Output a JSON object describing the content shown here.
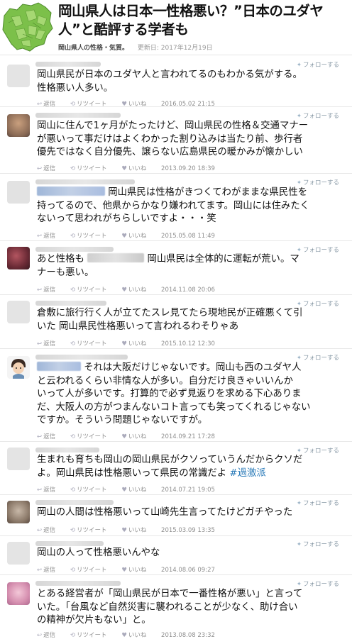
{
  "article": {
    "title": "岡山県人は日本一性格悪い？”日本のユダヤ人”と酷評する学者も",
    "category": "岡山県人の性格・気質。",
    "updated": "更新日: 2017年12月19日"
  },
  "labels": {
    "follow": "フォローする",
    "reply": "返信",
    "retweet": "リツイート",
    "like": "いいね"
  },
  "tweets": [
    {
      "lines": [
        "岡山県民が日本のユダヤ人と言われてるのもわかる気がする。",
        "性格悪い人多い。"
      ],
      "time": "2016.05.02 21:15"
    },
    {
      "lines": [
        "岡山に住んで1ヶ月がたったけど、岡山県民の性格＆交通マナー",
        "が悪いって事だけはよくわかった割り込みは当たり前、歩行者",
        "優先ではなく自分優先、譲らない広島県民の暖かみが懐かしい"
      ],
      "time": "2013.09.20 18:39"
    },
    {
      "lines": [
        "岡山県民は性格がきつくてわがままな県民性を",
        "持ってるので、他県からかなり嫌われてます。岡山には住みたく",
        "ないって思われがちらしいですよ・・・笑"
      ],
      "time": "2015.05.08 11:49"
    },
    {
      "lines": [
        "あと性格も",
        "岡山県民は全体的に運転が荒い。マ",
        "ナーも悪い。"
      ],
      "time": "2014.11.08 20:06"
    },
    {
      "lines": [
        "倉敷に旅行行く人が立てたスレ見てたら現地民が正確悪くて引",
        "いた 岡山県民性格悪いって言われるわそりゃあ"
      ],
      "time": "2015.10.12 12:30"
    },
    {
      "lines": [
        "それは大阪だけじゃないです。岡山も西のユダヤ人",
        "と云われるくらい非情な人が多い。自分だけ良きゃいいんか",
        "いって人が多いです。打算的で必ず見返りを求める下心ありま",
        "だ、大阪人の方がつまんないコト言っても笑ってくれるじゃない",
        "ですか。そういう問題じゃないですが。"
      ],
      "time": "2014.09.21 17:28"
    },
    {
      "lines": [
        "生まれも育ちも岡山の岡山県民がクソっていうんだからクソだ",
        "よ。岡山県民は性格悪いって県民の常識だよ"
      ],
      "hashtag": "#過激派",
      "time": "2014.07.21 19:05"
    },
    {
      "lines": [
        "岡山の人間は性格悪いって山崎先生言ってたけどガチやった"
      ],
      "time": "2015.03.09 13:35"
    },
    {
      "lines": [
        "岡山の人って性格悪いんやな"
      ],
      "time": "2014.08.06 09:27"
    },
    {
      "lines": [
        "とある経営者が「岡山県民が日本で一番性格が悪い」と言って",
        "いた。「台風など自然災害に襲われることが少なく、助け合い",
        "の精神が欠片もない」と。"
      ],
      "time": "2013.08.08 23:32"
    }
  ],
  "colors": {
    "accent": "#2b7bb9",
    "map_green": "#7cc04a",
    "muted": "#8f8f8f"
  }
}
